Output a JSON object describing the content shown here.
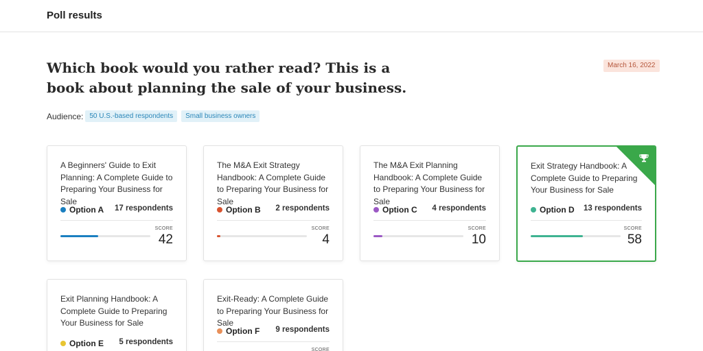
{
  "header": {
    "title": "Poll results"
  },
  "question": "Which book would you rather read? This is a book about planning the sale of your business.",
  "date": "March 16, 2022",
  "audience": {
    "label": "Audience:",
    "tags": [
      "50 U.S.-based respondents",
      "Small business owners"
    ]
  },
  "score_label": "SCORE",
  "cards": [
    {
      "book": "A Beginners' Guide to Exit Planning: A Complete Guide to Preparing Your Business for Sale",
      "option": "Option A",
      "respondents": "17 respondents",
      "score": "42",
      "score_fraction": 0.42,
      "color": "#1a7fc0",
      "winner": false
    },
    {
      "book": "The M&A Exit Strategy Handbook: A Complete Guide to Preparing Your Business for Sale",
      "option": "Option B",
      "respondents": "2 respondents",
      "score": "4",
      "score_fraction": 0.04,
      "color": "#d8532f",
      "winner": false
    },
    {
      "book": "The M&A Exit Planning Handbook: A Complete Guide to Preparing Your Business for Sale",
      "option": "Option C",
      "respondents": "4 respondents",
      "score": "10",
      "score_fraction": 0.1,
      "color": "#9b59c4",
      "winner": false
    },
    {
      "book": "Exit Strategy Handbook: A Complete Guide to Preparing Your Business for Sale",
      "option": "Option D",
      "respondents": "13 respondents",
      "score": "58",
      "score_fraction": 0.58,
      "color": "#3eb391",
      "winner": true,
      "winner_icon": "trophy-icon"
    },
    {
      "book": "Exit Planning Handbook: A Complete Guide to Preparing Your Business for Sale",
      "option": "Option E",
      "respondents": "5 respondents",
      "color": "#e8c532",
      "winner": false
    },
    {
      "book": "Exit-Ready: A Complete Guide to Preparing Your Business for Sale",
      "option": "Option F",
      "respondents": "9 respondents",
      "color": "#e8905a",
      "winner": false
    }
  ]
}
